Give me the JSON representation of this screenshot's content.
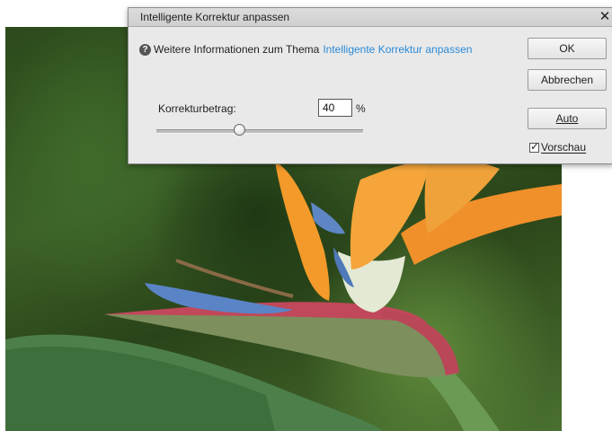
{
  "dialog": {
    "title": "Intelligente Korrektur anpassen",
    "close_glyph": "✕",
    "info_text": "Weitere Informationen zum Thema",
    "info_link": "Intelligente Korrektur anpassen",
    "amount_label": "Korrekturbetrag:",
    "amount_value": "40",
    "amount_unit": "%",
    "slider_value_percent": 40,
    "ok_label": "OK",
    "cancel_label": "Abbrechen",
    "auto_label": "Auto",
    "preview_label": "Vorschau",
    "preview_checked": true
  },
  "colors": {
    "link": "#2b8ad6",
    "dialog_bg": "#e9e9e9"
  },
  "icons": {
    "help": "help-icon",
    "close": "close-icon",
    "checkbox": "checkmark-icon"
  }
}
